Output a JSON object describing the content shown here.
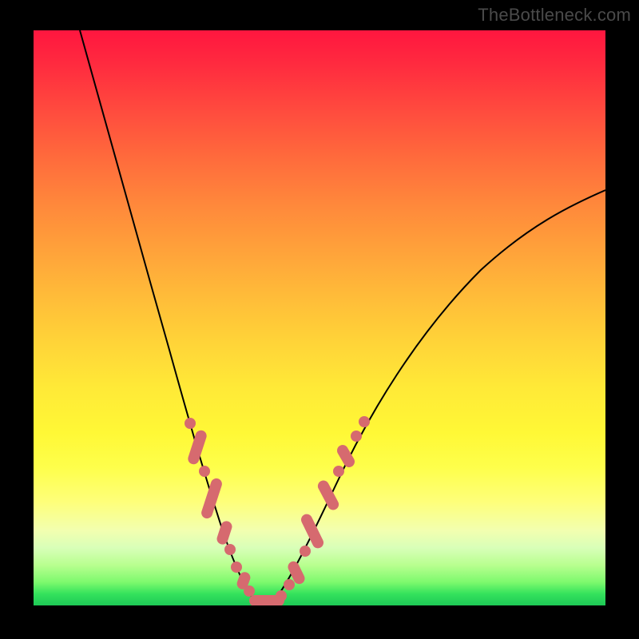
{
  "watermark": "TheBottleneck.com",
  "colors": {
    "frame": "#000000",
    "curve": "#000000",
    "bead": "#d66a6f",
    "gradient_top": "#ff163f",
    "gradient_bottom": "#1ec956"
  },
  "chart_data": {
    "type": "line",
    "title": "",
    "xlabel": "",
    "ylabel": "",
    "xlim": [
      0,
      100
    ],
    "ylim": [
      0,
      100
    ],
    "note": "Values estimated from pixel positions on a 0–100 grid (y=0 at bottom green, y=100 at top red). Two branches form a V-shape with minimum near x≈36–42, y≈0.",
    "series": [
      {
        "name": "left-branch",
        "x": [
          8,
          12,
          16,
          20,
          24,
          28,
          30,
          32,
          34,
          36,
          38,
          40
        ],
        "values": [
          100,
          87,
          72,
          58,
          44,
          30,
          22,
          14,
          8,
          3,
          1,
          0
        ]
      },
      {
        "name": "right-branch",
        "x": [
          40,
          44,
          48,
          52,
          56,
          60,
          66,
          72,
          80,
          88,
          96,
          100
        ],
        "values": [
          0,
          2,
          7,
          14,
          22,
          30,
          40,
          49,
          58,
          65,
          70,
          72
        ]
      }
    ],
    "annotations": {
      "beads_description": "Pink/rose oblong markers along both branches roughly between y≈2 and y≈32, denser near the trough.",
      "bead_color": "#d66a6f"
    }
  }
}
